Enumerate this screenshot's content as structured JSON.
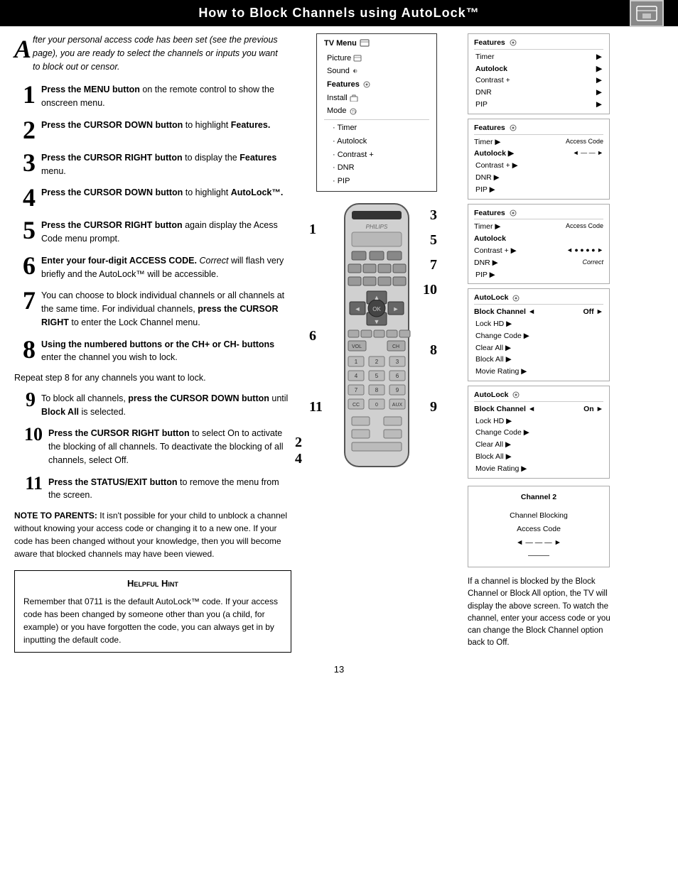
{
  "header": {
    "title": "How to Block Channels using AutoLock™",
    "logo_alt": "logo"
  },
  "intro": {
    "dropcap": "A",
    "text": "fter your personal access code has been set (see the previous page), you are ready to select the channels or inputs you want to block out or censor."
  },
  "steps": [
    {
      "num": "1",
      "text": "Press the MENU button on the remote control to show the onscreen menu."
    },
    {
      "num": "2",
      "text_bold": "Press the CURSOR DOWN button",
      "text_rest": " to highlight Features."
    },
    {
      "num": "3",
      "text_bold": "Press the CURSOR RIGHT button",
      "text_rest": " to display the Features menu."
    },
    {
      "num": "4",
      "text_bold": "Press the CURSOR DOWN button",
      "text_rest": " to highlight AutoLock™."
    },
    {
      "num": "5",
      "text_bold": "Press the CURSOR RIGHT button",
      "text_rest": " again display the Acess Code menu prompt."
    },
    {
      "num": "6",
      "text_bold": "Enter your four-digit ACCESS CODE.",
      "text_italic": " Correct",
      "text_rest": " will flash very briefly and the AutoLock™ will be accessible."
    },
    {
      "num": "7",
      "text": "You can choose to block individual channels or all channels at the same time. For individual channels, press the CURSOR RIGHT to enter the Lock Channel menu."
    },
    {
      "num": "8",
      "text_bold": "Using the numbered buttons or the CH+ or CH- buttons",
      "text_rest": " enter the channel you wish to lock."
    }
  ],
  "repeat_note": "Repeat step 8 for any channels you want to lock.",
  "steps_continued": [
    {
      "num": "9",
      "text": "To block all channels, press the CURSOR DOWN button until Block All is selected."
    },
    {
      "num": "10",
      "text_bold": "Press the CURSOR RIGHT button",
      "text_rest": " to select On to activate the blocking of all channels. To deactivate the blocking of all channels, select Off."
    },
    {
      "num": "11",
      "text_bold": "Press the STATUS/EXIT button",
      "text_rest": " to remove the menu from the screen."
    }
  ],
  "note_parents": {
    "label": "NOTE TO PARENTS:",
    "text": " It isn't possible for your child to unblock a channel without knowing your access code or changing it to a new one. If your code has been changed without your knowledge, then you will become aware that blocked channels may have been viewed."
  },
  "helpful_hint": {
    "title": "Helpful Hint",
    "text": "Remember that 0711 is the default AutoLock™ code.  If your access code has been changed by someone other than you (a child, for example) or you have forgotten the code, you can always get in by inputting the default code."
  },
  "page_number": "13",
  "tv_menu": {
    "title": "TV Menu",
    "items": [
      "Picture",
      "Sound",
      "Features",
      "Install",
      "Mode"
    ],
    "sub_items": [
      "Timer",
      "Autolock",
      "Contrast +",
      "DNR",
      "PIP"
    ]
  },
  "features_panel_1": {
    "title": "Features",
    "items": [
      {
        "label": "Timer",
        "arrow": "▶"
      },
      {
        "label": "Autolock",
        "arrow": "▶",
        "bold": true
      },
      {
        "label": "Contrast +",
        "arrow": "▶"
      },
      {
        "label": "DNR",
        "arrow": "▶"
      },
      {
        "label": "PIP",
        "arrow": "▶"
      }
    ]
  },
  "features_panel_2": {
    "title": "Features",
    "items": [
      {
        "label": "Timer",
        "arrow": "▶",
        "right_label": "Access Code"
      },
      {
        "label": "Autolock",
        "arrow": "▶",
        "bold": true,
        "right_label": "◄ ——— ►"
      },
      {
        "label": "Contrast +",
        "arrow": "▶"
      },
      {
        "label": "DNR",
        "arrow": "▶"
      },
      {
        "label": "PIP",
        "arrow": "▶"
      }
    ]
  },
  "features_panel_3": {
    "title": "Features",
    "items": [
      {
        "label": "Timer",
        "arrow": "▶",
        "right_label": "Access Code"
      },
      {
        "label": "Autolock",
        "bold": true
      },
      {
        "label": "Contrast +",
        "arrow": "▶",
        "right_label": "◄ ● ● ● ● ►"
      },
      {
        "label": "DNR",
        "arrow": "▶",
        "right_label": "Correct"
      },
      {
        "label": "PIP",
        "arrow": "▶"
      }
    ]
  },
  "autolock_panel_1": {
    "title": "AutoLock",
    "items": [
      {
        "label": "Block Channel",
        "arrow": "◄",
        "right": "Off",
        "arrow2": "►",
        "bold": true
      },
      {
        "label": "Lock HD",
        "arrow": "▶"
      },
      {
        "label": "Change Code",
        "arrow": "▶"
      },
      {
        "label": "Clear All",
        "arrow": "▶"
      },
      {
        "label": "Block All",
        "arrow": "▶"
      },
      {
        "label": "Movie Rating",
        "arrow": "▶"
      }
    ]
  },
  "autolock_panel_2": {
    "title": "AutoLock",
    "items": [
      {
        "label": "Block Channel",
        "arrow": "◄",
        "right": "On",
        "arrow2": "►",
        "bold": true
      },
      {
        "label": "Lock HD",
        "arrow": "▶"
      },
      {
        "label": "Change Code",
        "arrow": "▶"
      },
      {
        "label": "Clear All",
        "arrow": "▶"
      },
      {
        "label": "Block All",
        "arrow": "▶"
      },
      {
        "label": "Movie Rating",
        "arrow": "▶"
      }
    ]
  },
  "channel_block_panel": {
    "channel": "Channel 2",
    "label1": "Channel Blocking",
    "label2": "Access Code",
    "row": "◄ ——— ►",
    "row2": "———"
  },
  "bottom_right_text": "If a channel is blocked by the Block Channel or Block All option, the TV will display the above screen. To watch the channel, enter your access code or you can change the Block Channel option back to Off.",
  "step_labels_on_remote": [
    "1",
    "2",
    "3",
    "4",
    "5",
    "6",
    "7",
    "8",
    "9",
    "10",
    "11"
  ]
}
